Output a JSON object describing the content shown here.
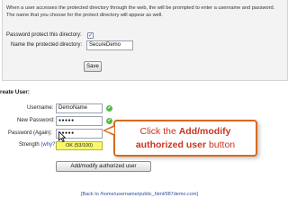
{
  "protect_panel": {
    "intro_line1": "When a user accesses the protected directory through the web, the will be prompted to enter a username and password.",
    "intro_line2": "The name that you choose for the protect directory will appear as well.",
    "protect_label": "Password protect this directory:",
    "protect_checked": "✓",
    "name_label": "Name the protected directory:",
    "name_value": "SecureDemo",
    "save_label": "Save"
  },
  "create_user": {
    "title": "reate User:",
    "username_label": "Username:",
    "username_value": "DemoName",
    "new_password_label": "New Password:",
    "new_password_value": "●●●●●",
    "again_label": "Password (Again):",
    "again_value": "●●●●●",
    "strength_label": "Strength",
    "why_label": "(why?):",
    "strength_text": "OK (53/100)",
    "strength_value": 53,
    "add_button_label": "Add/modify authorized user"
  },
  "callout": {
    "prefix": "Click the ",
    "bold1": "Add/modify",
    "bold2": "authorized user",
    "suffix": " button",
    "border_color": "#d96a1e",
    "text_color": "#c9341f"
  },
  "back_link": "[Back to /home/username/public_html/987demo.com]"
}
